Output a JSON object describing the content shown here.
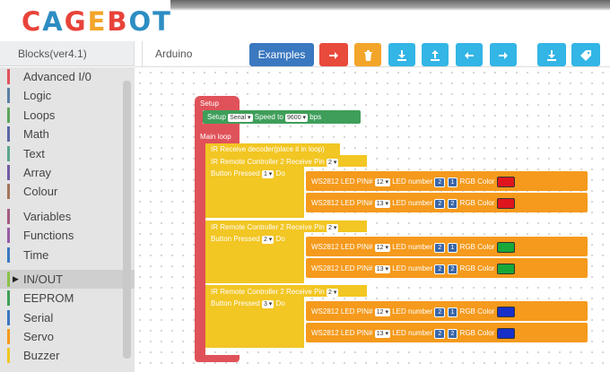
{
  "logo": {
    "chars": [
      {
        "ch": "C",
        "color": "#e8433a"
      },
      {
        "ch": "A",
        "color": "#2d8dc2"
      },
      {
        "ch": "G",
        "color": "#e8433a"
      },
      {
        "ch": "E",
        "color": "#f3a52a"
      },
      {
        "ch": "B",
        "color": "#e8433a"
      },
      {
        "ch": "O",
        "color": "#2d8dc2"
      },
      {
        "ch": "T",
        "color": "#2d8dc2"
      }
    ]
  },
  "sidebar": {
    "header": "Blocks(ver4.1)",
    "groups": [
      [
        {
          "label": "Advanced I/0",
          "color": "#e05259"
        },
        {
          "label": "Logic",
          "color": "#5b80a5"
        },
        {
          "label": "Loops",
          "color": "#5ba55b"
        },
        {
          "label": "Math",
          "color": "#5b67a5"
        },
        {
          "label": "Text",
          "color": "#5ba58c"
        },
        {
          "label": "Array",
          "color": "#745ba5"
        },
        {
          "label": "Colour",
          "color": "#a5745b"
        }
      ],
      [
        {
          "label": "Variables",
          "color": "#a55b80"
        },
        {
          "label": "Functions",
          "color": "#995ba5"
        },
        {
          "label": "Time",
          "color": "#3a78c0"
        }
      ],
      [
        {
          "label": "IN/OUT",
          "color": "#8bc34a",
          "selected": true
        },
        {
          "label": "EEPROM",
          "color": "#3f9e5a"
        },
        {
          "label": "Serial",
          "color": "#3a78c0"
        },
        {
          "label": "Servo",
          "color": "#f59a1c"
        },
        {
          "label": "Buzzer",
          "color": "#f2c623"
        }
      ]
    ]
  },
  "tabs": {
    "arduino": "Arduino"
  },
  "toolbar": {
    "examples": "Examples",
    "colors": {
      "primary": "#3a78c0",
      "red": "#e84a3c",
      "orange": "#f3a52a",
      "cyan": "#33b5e5"
    }
  },
  "blocks": {
    "setup": "Setup",
    "serial_setup": {
      "prefix": "Setup",
      "port": "Serial",
      "speed_label": "Speed to",
      "speed": "9600",
      "unit": "bps"
    },
    "main_loop": "Main loop",
    "comment": "IR Receive decoder(place it in loop)",
    "groups": [
      {
        "remote": "IR Remote Controller 2",
        "receive": "Receive Pin",
        "pin": "2",
        "pressed": "Button Pressed",
        "button": "1",
        "do": "Do",
        "leds": [
          {
            "label": "WS2812 LED",
            "pin_label": "PIN#",
            "pin": "12",
            "num_label": "LED number",
            "a": "2",
            "b": "1",
            "color_label": "RGB Color",
            "color": "#e0141e"
          },
          {
            "label": "WS2812 LED",
            "pin_label": "PIN#",
            "pin": "13",
            "num_label": "LED number",
            "a": "2",
            "b": "2",
            "color_label": "RGB Color",
            "color": "#e0141e"
          }
        ]
      },
      {
        "remote": "IR Remote Controller 2",
        "receive": "Receive Pin",
        "pin": "2",
        "pressed": "Button Pressed",
        "button": "2",
        "do": "Do",
        "leds": [
          {
            "label": "WS2812 LED",
            "pin_label": "PIN#",
            "pin": "12",
            "num_label": "LED number",
            "a": "2",
            "b": "1",
            "color_label": "RGB Color",
            "color": "#18a83a"
          },
          {
            "label": "WS2812 LED",
            "pin_label": "PIN#",
            "pin": "13",
            "num_label": "LED number",
            "a": "2",
            "b": "2",
            "color_label": "RGB Color",
            "color": "#18a83a"
          }
        ]
      },
      {
        "remote": "IR Remote Controller 2",
        "receive": "Receive Pin",
        "pin": "2",
        "pressed": "Button Pressed",
        "button": "3",
        "do": "Do",
        "leds": [
          {
            "label": "WS2812 LED",
            "pin_label": "PIN#",
            "pin": "12",
            "num_label": "LED number",
            "a": "2",
            "b": "1",
            "color_label": "RGB Color",
            "color": "#1830c8"
          },
          {
            "label": "WS2812 LED",
            "pin_label": "PIN#",
            "pin": "13",
            "num_label": "LED number",
            "a": "2",
            "b": "2",
            "color_label": "RGB Color",
            "color": "#1830c8"
          }
        ]
      }
    ]
  }
}
